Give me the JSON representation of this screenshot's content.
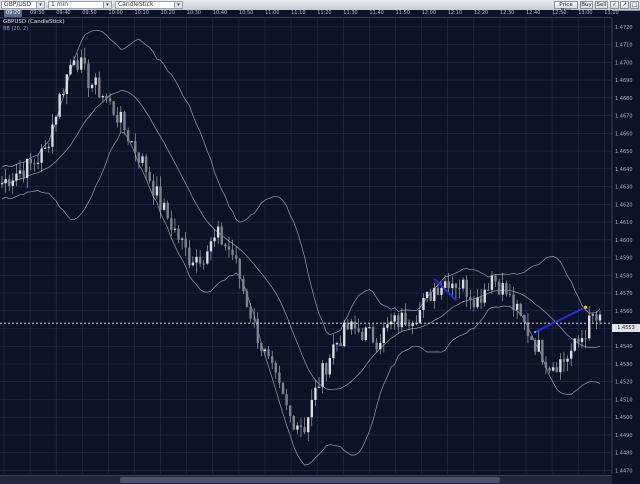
{
  "toolbar": {
    "symbol": "GBP/USD",
    "timeframe": "1 min",
    "chart_type": "CandleStick",
    "buttons": [
      "Price Box",
      "Buy",
      "Sell",
      "✓",
      "↗",
      "□"
    ]
  },
  "legend": {
    "title": "GBPUSD (CandleStick)",
    "indicator": "BB (20, 2)"
  },
  "time_labels": [
    "09:20",
    "09:30",
    "09:40",
    "09:50",
    "10:00",
    "10:10",
    "10:20",
    "10:30",
    "10:40",
    "10:50",
    "11:00",
    "11:10",
    "11:20",
    "11:30",
    "11:40",
    "11:50",
    "12:00",
    "12:10",
    "12:20",
    "12:30",
    "12:40",
    "12:50",
    "13:00",
    "13:10"
  ],
  "price_labels": [
    "1.4720",
    "1.4710",
    "1.4700",
    "1.4690",
    "1.4680",
    "1.4670",
    "1.4660",
    "1.4650",
    "1.4640",
    "1.4630",
    "1.4620",
    "1.4610",
    "1.4600",
    "1.4590",
    "1.4580",
    "1.4570",
    "1.4560",
    "1.4550",
    "1.4540",
    "1.4530",
    "1.4520",
    "1.4510",
    "1.4500",
    "1.4490",
    "1.4480",
    "1.4470"
  ],
  "current_price": "1.4553",
  "chart_data": {
    "type": "candlestick",
    "symbol": "GBPUSD",
    "interval": "1 min",
    "ylim": [
      1.4468,
      1.4725
    ],
    "indicator": "BB (20, 2)",
    "grid": true,
    "current_price": 1.4553,
    "close_path": [
      [
        0,
        1.4632
      ],
      [
        4,
        1.4638
      ],
      [
        8,
        1.4642
      ],
      [
        12,
        1.465
      ],
      [
        16,
        1.468
      ],
      [
        20,
        1.4705
      ],
      [
        24,
        1.469
      ],
      [
        28,
        1.4682
      ],
      [
        32,
        1.467
      ],
      [
        36,
        1.4655
      ],
      [
        40,
        1.464
      ],
      [
        44,
        1.462
      ],
      [
        48,
        1.4605
      ],
      [
        52,
        1.459
      ],
      [
        56,
        1.4592
      ],
      [
        60,
        1.4602
      ],
      [
        64,
        1.4592
      ],
      [
        68,
        1.4565
      ],
      [
        72,
        1.454
      ],
      [
        76,
        1.452
      ],
      [
        80,
        1.45
      ],
      [
        84,
        1.4495
      ],
      [
        88,
        1.452
      ],
      [
        92,
        1.454
      ],
      [
        96,
        1.455
      ],
      [
        100,
        1.4548
      ],
      [
        104,
        1.4544
      ],
      [
        108,
        1.4552
      ],
      [
        112,
        1.4556
      ],
      [
        116,
        1.456
      ],
      [
        120,
        1.4573
      ],
      [
        124,
        1.4578
      ],
      [
        128,
        1.4574
      ],
      [
        132,
        1.4566
      ],
      [
        136,
        1.458
      ],
      [
        140,
        1.457
      ],
      [
        144,
        1.4555
      ],
      [
        148,
        1.4542
      ],
      [
        152,
        1.453
      ],
      [
        156,
        1.4532
      ],
      [
        160,
        1.4542
      ],
      [
        164,
        1.4556
      ],
      [
        166,
        1.4553
      ]
    ],
    "drawings": [
      {
        "type": "trend-line",
        "from": [
          1.4578,
          "12:05"
        ],
        "to": [
          1.4566,
          "12:08"
        ],
        "color": "#2b2bff"
      },
      {
        "type": "trend-line",
        "from": [
          1.4548,
          "12:45"
        ],
        "to": [
          1.4562,
          "13:05"
        ],
        "color": "#2b2bff"
      }
    ]
  }
}
